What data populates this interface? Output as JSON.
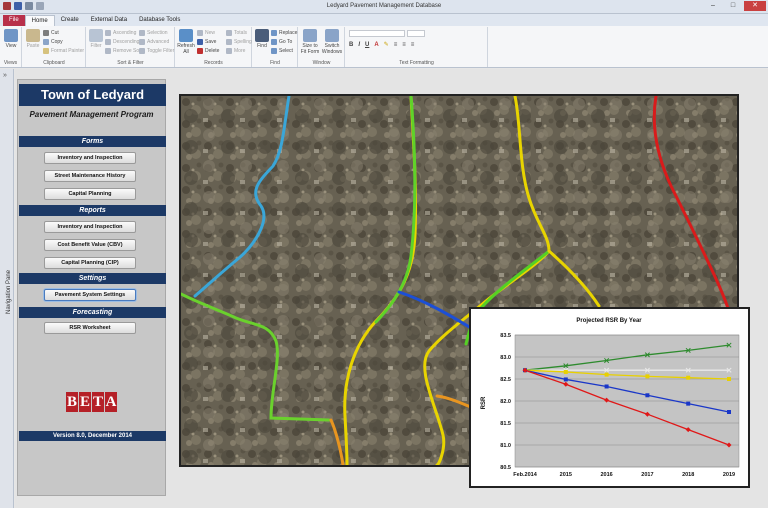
{
  "window": {
    "title": "Ledyard Pavement Management Database"
  },
  "tabs": [
    "File",
    "Home",
    "Create",
    "External Data",
    "Database Tools"
  ],
  "ribbon": {
    "views": {
      "view": "View",
      "group": "Views"
    },
    "clipboard": {
      "paste": "Paste",
      "cut": "Cut",
      "copy": "Copy",
      "format_painter": "Format Painter",
      "group": "Clipboard"
    },
    "sort_filter": {
      "filter": "Filter",
      "ascending": "Ascending",
      "descending": "Descending",
      "remove_sort": "Remove Sort",
      "selection": "Selection",
      "advanced": "Advanced",
      "toggle_filter": "Toggle Filter",
      "group": "Sort & Filter"
    },
    "records": {
      "refresh": "Refresh All",
      "new": "New",
      "save": "Save",
      "delete": "Delete",
      "totals": "Totals",
      "spelling": "Spelling",
      "more": "More",
      "group": "Records"
    },
    "find": {
      "find": "Find",
      "replace": "Replace",
      "goto": "Go To",
      "select": "Select",
      "group": "Find"
    },
    "window": {
      "size": "Size to Fit Form",
      "switch": "Switch Windows",
      "group": "Window"
    },
    "text_formatting": {
      "group": "Text Formatting"
    }
  },
  "nav_pane": {
    "label": "Navigation Pane"
  },
  "panel": {
    "town": "Town of Ledyard",
    "program": "Pavement Management Program",
    "forms_header": "Forms",
    "forms": [
      "Inventory and Inspection",
      "Street Maintenance History",
      "Capital Planning"
    ],
    "reports_header": "Reports",
    "reports": [
      "Inventory and Inspection",
      "Cost Benefit Value (CBV)",
      "Capital Planning (CIP)"
    ],
    "settings_header": "Settings",
    "settings": [
      "Pavement System Settings"
    ],
    "forecasting_header": "Forecasting",
    "forecasting": [
      "RSR Worksheet"
    ],
    "logo_letters": [
      "B",
      "E",
      "T",
      "A"
    ],
    "version": "Version 8.0, December 2014"
  },
  "chart_data": {
    "type": "line",
    "title": "Projected RSR By Year",
    "xlabel": "",
    "ylabel": "RSR",
    "categories": [
      "Feb.2014",
      "2015",
      "2016",
      "2017",
      "2018",
      "2019"
    ],
    "ylim": [
      80.5,
      83.5
    ],
    "yticks": [
      "80.5",
      "81.0",
      "81.5",
      "82.0",
      "82.5",
      "83.0",
      "83.5"
    ],
    "grid": true,
    "series": [
      {
        "color": "#2e8b2e",
        "marker": "x",
        "values": [
          82.7,
          82.8,
          82.92,
          83.05,
          83.15,
          83.27
        ]
      },
      {
        "color": "#e8e8e8",
        "marker": "x",
        "values": [
          82.7,
          82.7,
          82.7,
          82.7,
          82.7,
          82.7
        ]
      },
      {
        "color": "#e8d000",
        "marker": "square",
        "values": [
          82.7,
          82.66,
          82.6,
          82.56,
          82.53,
          82.5
        ]
      },
      {
        "color": "#1a37c8",
        "marker": "square",
        "values": [
          82.7,
          82.49,
          82.33,
          82.13,
          81.94,
          81.75
        ]
      },
      {
        "color": "#e01818",
        "marker": "diamond",
        "values": [
          82.7,
          82.38,
          82.02,
          81.7,
          81.35,
          81.0
        ]
      }
    ]
  }
}
